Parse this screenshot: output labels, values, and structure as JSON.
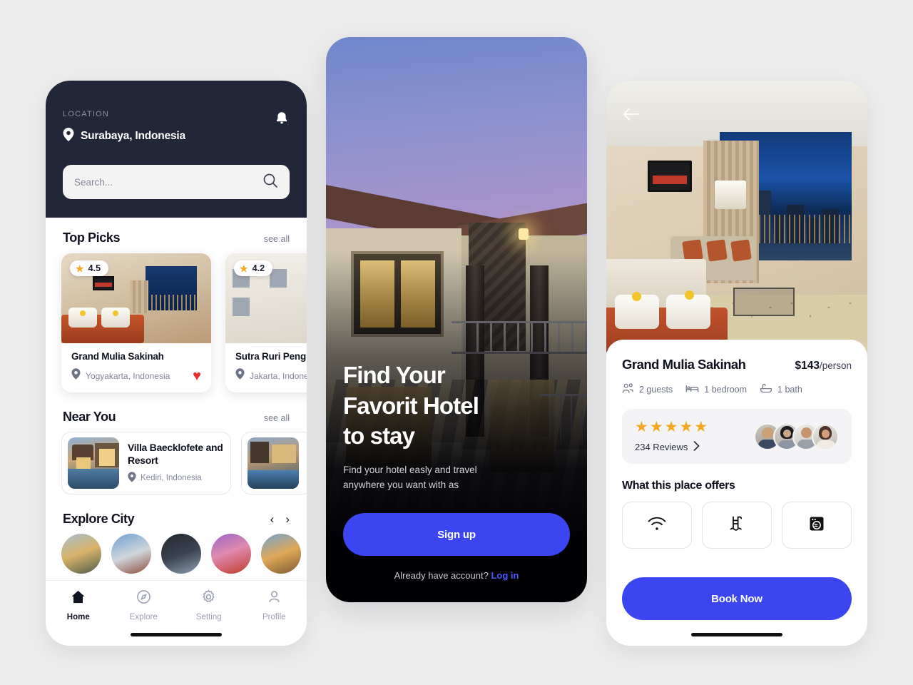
{
  "background_color": "#ececec",
  "accent_color": "#3b46f0",
  "dark_color": "#222639",
  "star_color": "#f5a623",
  "heart_color": "#ea2d2d",
  "home": {
    "location_label": "LOCATION",
    "location_value": "Surabaya, Indonesia",
    "notification_icon": "bell-icon",
    "search": {
      "value": "",
      "placeholder": "Search..."
    },
    "top_picks": {
      "title": "Top Picks",
      "see_all": "see all",
      "cards": [
        {
          "rating": "4.5",
          "name": "Grand Mulia Sakinah",
          "city": "Yogyakarta, Indonesia",
          "favorite": true
        },
        {
          "rating": "4.2",
          "name": "Sutra Ruri Pengi",
          "city": "Jakarta, Indone",
          "favorite": false
        }
      ]
    },
    "near_you": {
      "title": "Near You",
      "see_all": "see all",
      "cards": [
        {
          "name": "Villa Baecklofete and Resort",
          "city": "Kediri, Indonesia"
        },
        {
          "name": "",
          "city": ""
        }
      ]
    },
    "explore_city": {
      "title": "Explore City",
      "prev_icon": "chevron-left-icon",
      "next_icon": "chevron-right-icon",
      "cities": [
        "city-1",
        "city-2",
        "city-3",
        "city-4",
        "city-5",
        "city-6"
      ]
    },
    "tabs": [
      {
        "label": "Home",
        "icon": "home-icon",
        "active": true
      },
      {
        "label": "Explore",
        "icon": "compass-icon",
        "active": false
      },
      {
        "label": "Setting",
        "icon": "gear-icon",
        "active": false
      },
      {
        "label": "Profile",
        "icon": "person-icon",
        "active": false
      }
    ]
  },
  "onboarding": {
    "headline": "Find Your\nFavorit Hotel\nto stay",
    "subtext": "Find your hotel easly and travel\nanywhere you want with as",
    "signup_label": "Sign up",
    "footer_prefix": "Already have account? ",
    "footer_link": "Log in"
  },
  "detail": {
    "back_icon": "arrow-left-icon",
    "name": "Grand Mulia Sakinah",
    "price_amount": "$143",
    "price_unit": "/person",
    "specs": [
      {
        "icon": "guests-icon",
        "label": "2 guests"
      },
      {
        "icon": "bed-icon",
        "label": "1 bedroom"
      },
      {
        "icon": "bath-icon",
        "label": "1 bath"
      }
    ],
    "stars": "★★★★★",
    "reviews_label": "234 Reviews",
    "reviews_chevron": "chevron-right-icon",
    "avatars": [
      "reviewer-1",
      "reviewer-2",
      "reviewer-3",
      "reviewer-4"
    ],
    "offers_title": "What this place offers",
    "offers": [
      {
        "icon": "wifi-icon"
      },
      {
        "icon": "pool-icon"
      },
      {
        "icon": "washer-icon"
      }
    ],
    "book_label": "Book Now"
  }
}
